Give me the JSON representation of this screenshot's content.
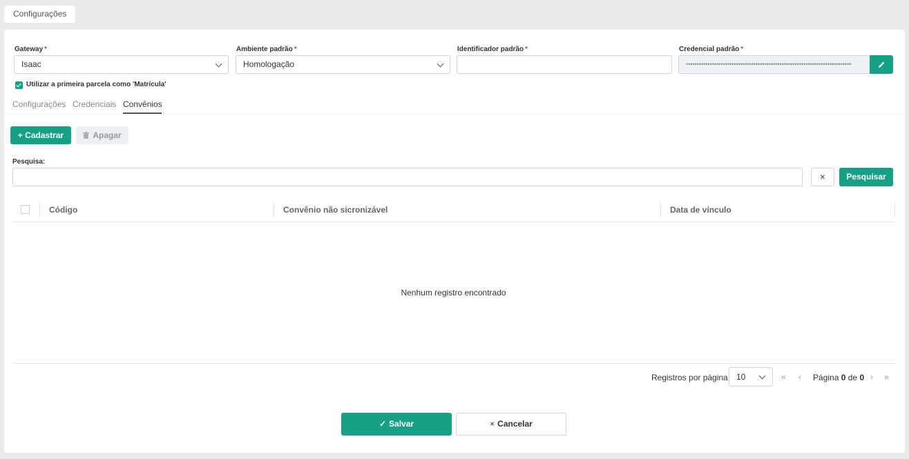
{
  "breadcrumb": {
    "label": "Configurações"
  },
  "form": {
    "gateway": {
      "label": "Gateway",
      "required_mark": "*",
      "value": "Isaac"
    },
    "ambiente": {
      "label": "Ambiente padrão",
      "required_mark": "*",
      "value": "Homologação"
    },
    "identificador": {
      "label": "Identificador padrão",
      "required_mark": "*",
      "value": ""
    },
    "credencial": {
      "label": "Credencial padrão",
      "required_mark": "*",
      "value": "••••••••••••••••••••••••••••••••••••••••••••••••••••••••••••••••••••••••••••"
    },
    "first_installment": {
      "label": "Utilizar a primeira parcela como 'Matrícula'",
      "checked": true
    }
  },
  "tabs": [
    {
      "label": "Configurações",
      "active": false
    },
    {
      "label": "Credenciais",
      "active": false
    },
    {
      "label": "Convênios",
      "active": true
    }
  ],
  "toolbar": {
    "add_label": "+ Cadastrar",
    "delete_label": "Apagar"
  },
  "search": {
    "label": "Pesquisa:",
    "value": "",
    "clear_label": "×",
    "button_label": "Pesquisar"
  },
  "table": {
    "columns": [
      "Código",
      "Convênio não sicronizável",
      "Data de vínculo"
    ],
    "rows": [],
    "empty_message": "Nenhum registro encontrado"
  },
  "pagination": {
    "per_page_label": "Registros por página:",
    "per_page_value": "10",
    "page_prefix": "Página",
    "current_page": "0",
    "of_label": "de",
    "total_pages": "0"
  },
  "actions": {
    "save_label": "Salvar",
    "cancel_label": "Cancelar"
  },
  "colors": {
    "accent": "#16a085",
    "required": "#e53935"
  }
}
